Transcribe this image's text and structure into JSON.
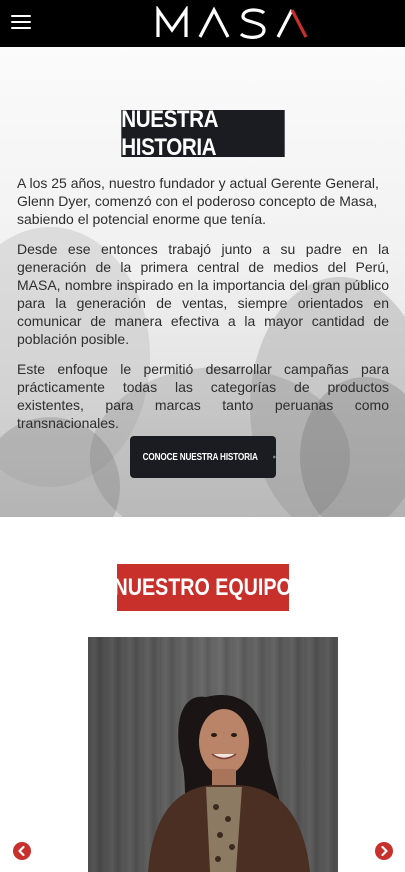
{
  "header": {
    "brand": "MASA",
    "menu_icon": "hamburger-menu-icon"
  },
  "history": {
    "title": "NUESTRA HISTORIA",
    "paragraphs": [
      "A los 25 años, nuestro fundador y actual Gerente General, Glenn Dyer, comenzó con el poderoso concepto de Masa, sabiendo el potencial enorme que tenía.",
      "Desde ese entonces trabajó junto a su padre en la generación de la primera central de medios del Perú, MASA, nombre inspirado en la importancia del gran público para la generación de ventas, siempre orientados en comunicar de manera efectiva a la mayor cantidad de población posible.",
      "Este enfoque le permitió desarrollar campañas para prácticamente todas las categorías de productos existentes, para marcas tanto peruanas como transnacionales."
    ],
    "cta_label": "CONOCE NUESTRA HISTORIA",
    "cta_icon": "arrow-circle-right-icon"
  },
  "team": {
    "title": "NUESTRO EQUIPO",
    "prev_icon": "chevron-left-circle-icon",
    "next_icon": "chevron-right-circle-icon"
  },
  "colors": {
    "header_bg": "#000000",
    "accent_red": "#c8302c",
    "dark_box": "#1a1c22"
  }
}
